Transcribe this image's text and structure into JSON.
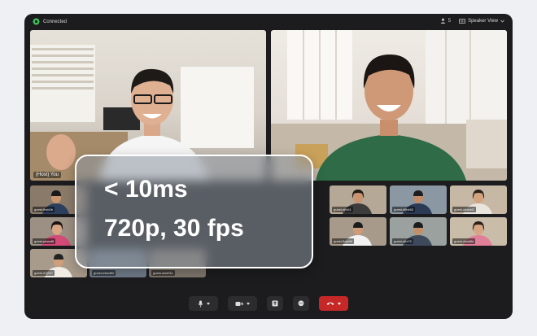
{
  "status": {
    "text": "Connected",
    "color": "#3fbf5a"
  },
  "header": {
    "participant_count": "5",
    "view_label": "Speaker View"
  },
  "main_tiles": [
    {
      "label": "(Host) You"
    },
    {
      "label": ""
    }
  ],
  "gallery": [
    {
      "label": "guest-fhxb2b"
    },
    {
      "label": "guest-ejfz61"
    },
    {
      "label": "guest-dfjbk53"
    },
    {
      "label": "guest-cbacfd2"
    },
    {
      "label": "guest-pkasd8"
    },
    {
      "label": "guest-fhqb96"
    },
    {
      "label": "guest-ejfz70"
    },
    {
      "label": "guest-cbad8d"
    },
    {
      "label": "guest-d7j347"
    },
    {
      "label": "guest-mkcd62"
    },
    {
      "label": "guest-wsd311"
    }
  ],
  "overlay": {
    "latency": "< 10ms",
    "quality": "720p, 30 fps"
  },
  "controls": {
    "mic": "mic-icon",
    "camera": "camera-icon",
    "share": "share-icon",
    "chat": "chat-icon",
    "end": "phone-hangup-icon",
    "end_color": "#c62828"
  }
}
